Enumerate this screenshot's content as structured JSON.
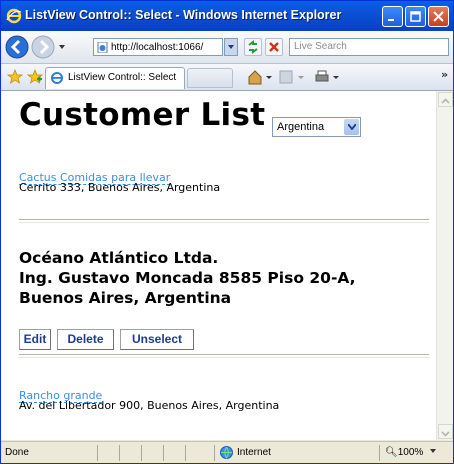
{
  "window": {
    "title": "ListView Control:: Select - Windows Internet Explorer"
  },
  "address_bar": {
    "url": "http://localhost:1066/",
    "search_placeholder": "Live Search"
  },
  "tabs": [
    {
      "label": "ListView Control:: Select"
    }
  ],
  "page": {
    "heading": "Customer List",
    "country_select": {
      "selected": "Argentina"
    },
    "customers": [
      {
        "name": "Cactus Comidas para llevar",
        "address": "Cerrito 333, Buenos Aires, Argentina"
      },
      {
        "name": "Océano Atlántico Ltda.",
        "address_line1": "Ing. Gustavo Moncada 8585 Piso 20-A,",
        "address_line2": "Buenos Aires, Argentina"
      },
      {
        "name": "Rancho grande",
        "address": "Av. del Libertador 900, Buenos Aires, Argentina"
      }
    ],
    "buttons": {
      "edit": "Edit",
      "delete": "Delete",
      "unselect": "Unselect"
    }
  },
  "status_bar": {
    "text": "Done",
    "zone": "Internet",
    "zoom": "100%"
  },
  "colors": {
    "titlebar": "#0b50d6",
    "link": "#3a8ee6",
    "button_text": "#1f3b8c"
  }
}
